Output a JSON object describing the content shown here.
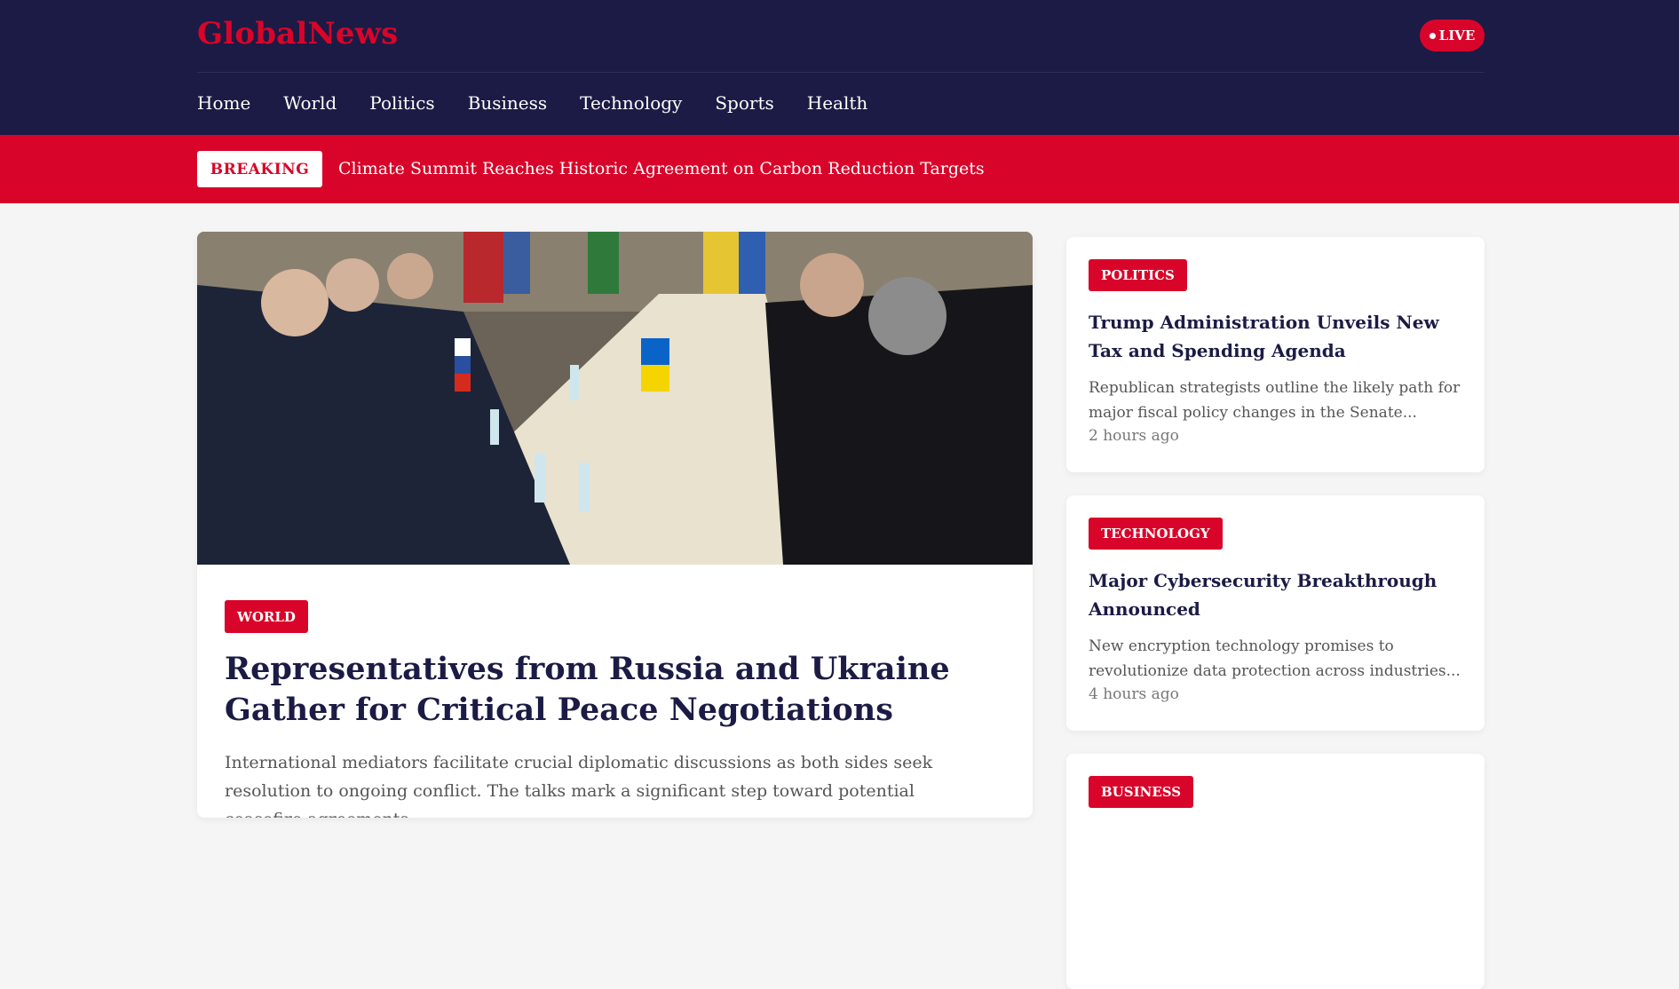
{
  "brand": {
    "logo": "GlobalNews",
    "live_label": "LIVE"
  },
  "nav": {
    "items": [
      "Home",
      "World",
      "Politics",
      "Business",
      "Technology",
      "Sports",
      "Health"
    ]
  },
  "breaking": {
    "label": "BREAKING",
    "headline": "Climate Summit Reaches Historic Agreement on Carbon Reduction Targets"
  },
  "featured": {
    "category": "WORLD",
    "title": "Representatives from Russia and Ukraine Gather for Critical Peace Negotiations",
    "summary": "International mediators facilitate crucial diplomatic discussions as both sides seek resolution to ongoing conflict. The talks mark a significant step toward potential ceasefire agreements."
  },
  "side_articles": [
    {
      "category": "POLITICS",
      "title": "Trump Administration Unveils New Tax and Spending Agenda",
      "summary": "Republican strategists outline the likely path for major fiscal policy changes in the Senate...",
      "time": "2 hours ago"
    },
    {
      "category": "TECHNOLOGY",
      "title": "Major Cybersecurity Breakthrough Announced",
      "summary": "New encryption technology promises to revolutionize data protection across industries...",
      "time": "4 hours ago"
    },
    {
      "category": "BUSINESS"
    }
  ],
  "colors": {
    "brand_red": "#d90429",
    "header_navy": "#1b1b45",
    "page_bg": "#f5f5f5"
  }
}
